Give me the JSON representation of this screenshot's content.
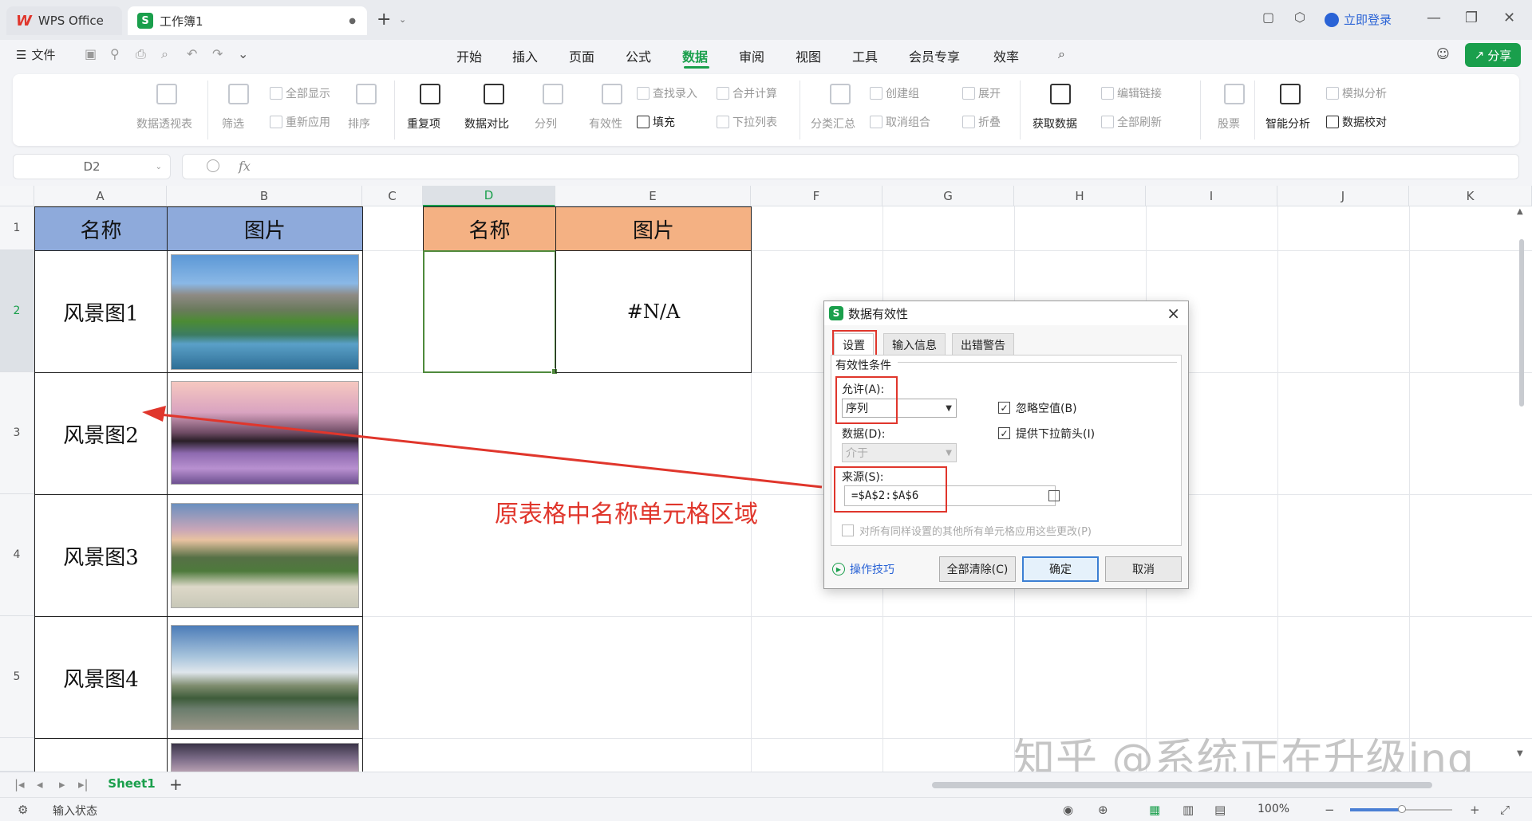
{
  "tabs": {
    "wps": "WPS Office",
    "workbook": "工作簿1"
  },
  "header": {
    "login": "立即登录",
    "share": "分享"
  },
  "menu": {
    "file": "文件",
    "tabs": [
      "开始",
      "插入",
      "页面",
      "公式",
      "数据",
      "审阅",
      "视图",
      "工具",
      "会员专享",
      "效率"
    ],
    "active_tab": "数据"
  },
  "ribbon": {
    "pivot": "数据透视表",
    "filter": "筛选",
    "show_all": "全部显示",
    "reapply": "重新应用",
    "sort": "排序",
    "duplicates": "重复项",
    "compare": "数据对比",
    "split": "分列",
    "validity": "有效性",
    "lookup_entry": "查找录入",
    "fill": "填充",
    "merge_calc": "合并计算",
    "dropdown_list": "下拉列表",
    "subtotal": "分类汇总",
    "create_group": "创建组",
    "ungroup": "取消组合",
    "expand": "展开",
    "collapse": "折叠",
    "get_data": "获取数据",
    "edit_links": "编辑链接",
    "refresh_all": "全部刷新",
    "stocks": "股票",
    "smart_analysis": "智能分析",
    "simulate": "模拟分析",
    "verify": "数据校对"
  },
  "formula_bar": {
    "name_box": "D2",
    "fx": "fx",
    "value": ""
  },
  "columns": [
    "A",
    "B",
    "C",
    "D",
    "E",
    "F",
    "G",
    "H",
    "I",
    "J",
    "K"
  ],
  "rows": [
    "1",
    "2",
    "3",
    "4",
    "5"
  ],
  "sheet": {
    "A1": "名称",
    "B1": "图片",
    "A2": "风景图1",
    "A3": "风景图2",
    "A4": "风景图3",
    "A5": "风景图4",
    "D1": "名称",
    "E1": "图片",
    "D2": "",
    "E2": "#N/A"
  },
  "annotation": "原表格中名称单元格区域",
  "watermark": "知乎 @系统正在升级ing",
  "dialog": {
    "title": "数据有效性",
    "tabs": [
      "设置",
      "输入信息",
      "出错警告"
    ],
    "group_label": "有效性条件",
    "allow_label": "允许(A):",
    "allow_value": "序列",
    "data_label": "数据(D):",
    "data_value": "介于",
    "ignore_blank": "忽略空值(B)",
    "dropdown_arrow": "提供下拉箭头(I)",
    "source_label": "来源(S):",
    "source_value": "=$A$2:$A$6",
    "apply_all": "对所有同样设置的其他所有单元格应用这些更改(P)",
    "tips": "操作技巧",
    "clear_all": "全部清除(C)",
    "ok": "确定",
    "cancel": "取消",
    "ignore_blank_checked": true,
    "dropdown_arrow_checked": true
  },
  "sheet_tabs": {
    "active": "Sheet1"
  },
  "status": {
    "text": "输入状态",
    "zoom": "100%",
    "zoom_level": 0.5
  },
  "colors": {
    "accent": "#1a9f4c",
    "header_blue": "#8eaadb",
    "header_orange": "#f4b183",
    "annotation_red": "#e0362c"
  }
}
